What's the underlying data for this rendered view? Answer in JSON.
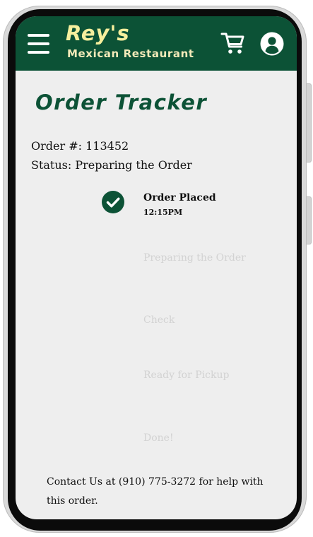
{
  "header": {
    "brand_name": "Rey's",
    "brand_subtitle": "Mexican Restaurant",
    "background_color": "#0c5236",
    "icons": [
      "menu-icon",
      "cart-icon",
      "account-icon"
    ]
  },
  "page": {
    "title": "Order Tracker",
    "order_number_line": "Order #: 113452",
    "status_line": "Status: Preparing the Order"
  },
  "steps": [
    {
      "label": "Order Placed",
      "time": "12:15PM",
      "state": "done",
      "icon": "check-circle-icon"
    },
    {
      "label": "Preparing the Order",
      "state": "pending"
    },
    {
      "label": "Check",
      "state": "pending"
    },
    {
      "label": "Ready for Pickup",
      "state": "pending"
    },
    {
      "label": "Done!",
      "state": "pending"
    }
  ],
  "footer": {
    "contact_text": "Contact Us at (910) 775-3272 for help with this order."
  },
  "colors": {
    "accent": "#0c5236",
    "brand_text": "#f6ef9d",
    "pending_text": "#d2d2d2"
  }
}
